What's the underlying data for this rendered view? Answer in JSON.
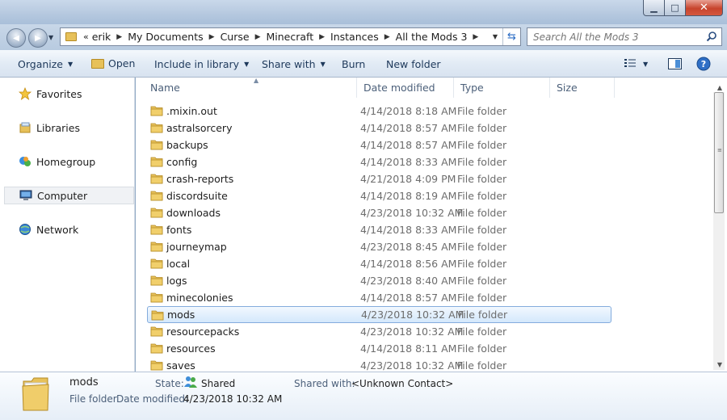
{
  "window": {
    "minimize_glyph": "▁",
    "maximize_glyph": "□",
    "close_glyph": "✕"
  },
  "nav": {
    "back_glyph": "◀",
    "forward_glyph": "▶"
  },
  "address": {
    "overflow": "«",
    "crumbs": [
      "erik",
      "My Documents",
      "Curse",
      "Minecraft",
      "Instances",
      "All the Mods 3"
    ]
  },
  "search": {
    "placeholder": "Search All the Mods 3"
  },
  "toolbar": {
    "organize": "Organize",
    "open": "Open",
    "include_in_library": "Include in library",
    "share_with": "Share with",
    "burn": "Burn",
    "new_folder": "New folder"
  },
  "sidebar": {
    "items": [
      {
        "label": "Favorites",
        "icon": "star-icon"
      },
      {
        "label": "Libraries",
        "icon": "library-icon"
      },
      {
        "label": "Homegroup",
        "icon": "homegroup-icon"
      },
      {
        "label": "Computer",
        "icon": "computer-icon"
      },
      {
        "label": "Network",
        "icon": "network-icon"
      }
    ]
  },
  "columns": {
    "name": "Name",
    "date": "Date modified",
    "type": "Type",
    "size": "Size"
  },
  "files": [
    {
      "name": ".mixin.out",
      "date": "4/14/2018 8:18 AM",
      "type": "File folder"
    },
    {
      "name": "astralsorcery",
      "date": "4/14/2018 8:57 AM",
      "type": "File folder"
    },
    {
      "name": "backups",
      "date": "4/14/2018 8:57 AM",
      "type": "File folder"
    },
    {
      "name": "config",
      "date": "4/14/2018 8:33 AM",
      "type": "File folder"
    },
    {
      "name": "crash-reports",
      "date": "4/21/2018 4:09 PM",
      "type": "File folder"
    },
    {
      "name": "discordsuite",
      "date": "4/14/2018 8:19 AM",
      "type": "File folder"
    },
    {
      "name": "downloads",
      "date": "4/23/2018 10:32 AM",
      "type": "File folder"
    },
    {
      "name": "fonts",
      "date": "4/14/2018 8:33 AM",
      "type": "File folder"
    },
    {
      "name": "journeymap",
      "date": "4/23/2018 8:45 AM",
      "type": "File folder"
    },
    {
      "name": "local",
      "date": "4/14/2018 8:56 AM",
      "type": "File folder"
    },
    {
      "name": "logs",
      "date": "4/23/2018 8:40 AM",
      "type": "File folder"
    },
    {
      "name": "minecolonies",
      "date": "4/14/2018 8:57 AM",
      "type": "File folder"
    },
    {
      "name": "mods",
      "date": "4/23/2018 10:32 AM",
      "type": "File folder"
    },
    {
      "name": "resourcepacks",
      "date": "4/23/2018 10:32 AM",
      "type": "File folder"
    },
    {
      "name": "resources",
      "date": "4/14/2018 8:11 AM",
      "type": "File folder"
    },
    {
      "name": "saves",
      "date": "4/23/2018 10:32 AM",
      "type": "File folder"
    }
  ],
  "selected_file": "mods",
  "details": {
    "name": "mods",
    "type": "File folder",
    "date_label": "Date modified:",
    "date_value": "4/23/2018 10:32 AM",
    "state_label": "State:",
    "state_value": "Shared",
    "shared_label": "Shared with:",
    "shared_value": "<Unknown Contact>"
  },
  "colors": {
    "accent": "#1e395b",
    "selection_border": "#84acdd",
    "folder": "#e7c15a"
  }
}
